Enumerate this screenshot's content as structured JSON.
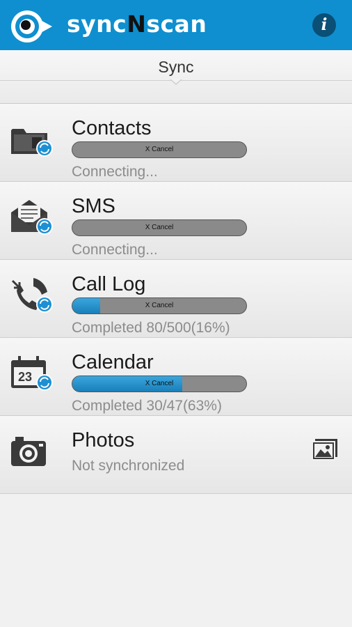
{
  "header": {
    "logo_prefix": "sync",
    "logo_accent": "N",
    "logo_suffix": "scan",
    "info_label": "i",
    "background_color": "#0f8fcf"
  },
  "tabs": {
    "active_label": "Sync"
  },
  "sync_items": [
    {
      "title": "Contacts",
      "cancel_label": "X Cancel",
      "progress": 0,
      "status": "Connecting..."
    },
    {
      "title": "SMS",
      "cancel_label": "X Cancel",
      "progress": 0,
      "status": "Connecting..."
    },
    {
      "title": "Call Log",
      "cancel_label": "X Cancel",
      "progress": 0.16,
      "status": "Completed  80/500(16%)"
    },
    {
      "title": "Calendar",
      "cancel_label": "X Cancel",
      "progress": 0.63,
      "status": "Completed  30/47(63%)"
    },
    {
      "title": "Photos",
      "status": "Not synchronized"
    }
  ],
  "colors": {
    "accent": "#0f8fcf",
    "progress_fill": "#2a93cd",
    "progress_track": "#8a8a8a",
    "status_text": "#8c8c8c"
  },
  "icons": {
    "contacts": "folder-sync-icon",
    "sms": "envelope-sync-icon",
    "call_log": "phone-sync-icon",
    "calendar": "calendar-sync-icon",
    "photos": "camera-icon",
    "gallery": "gallery-icon",
    "info": "info-icon",
    "logo": "eye-logo-icon"
  }
}
